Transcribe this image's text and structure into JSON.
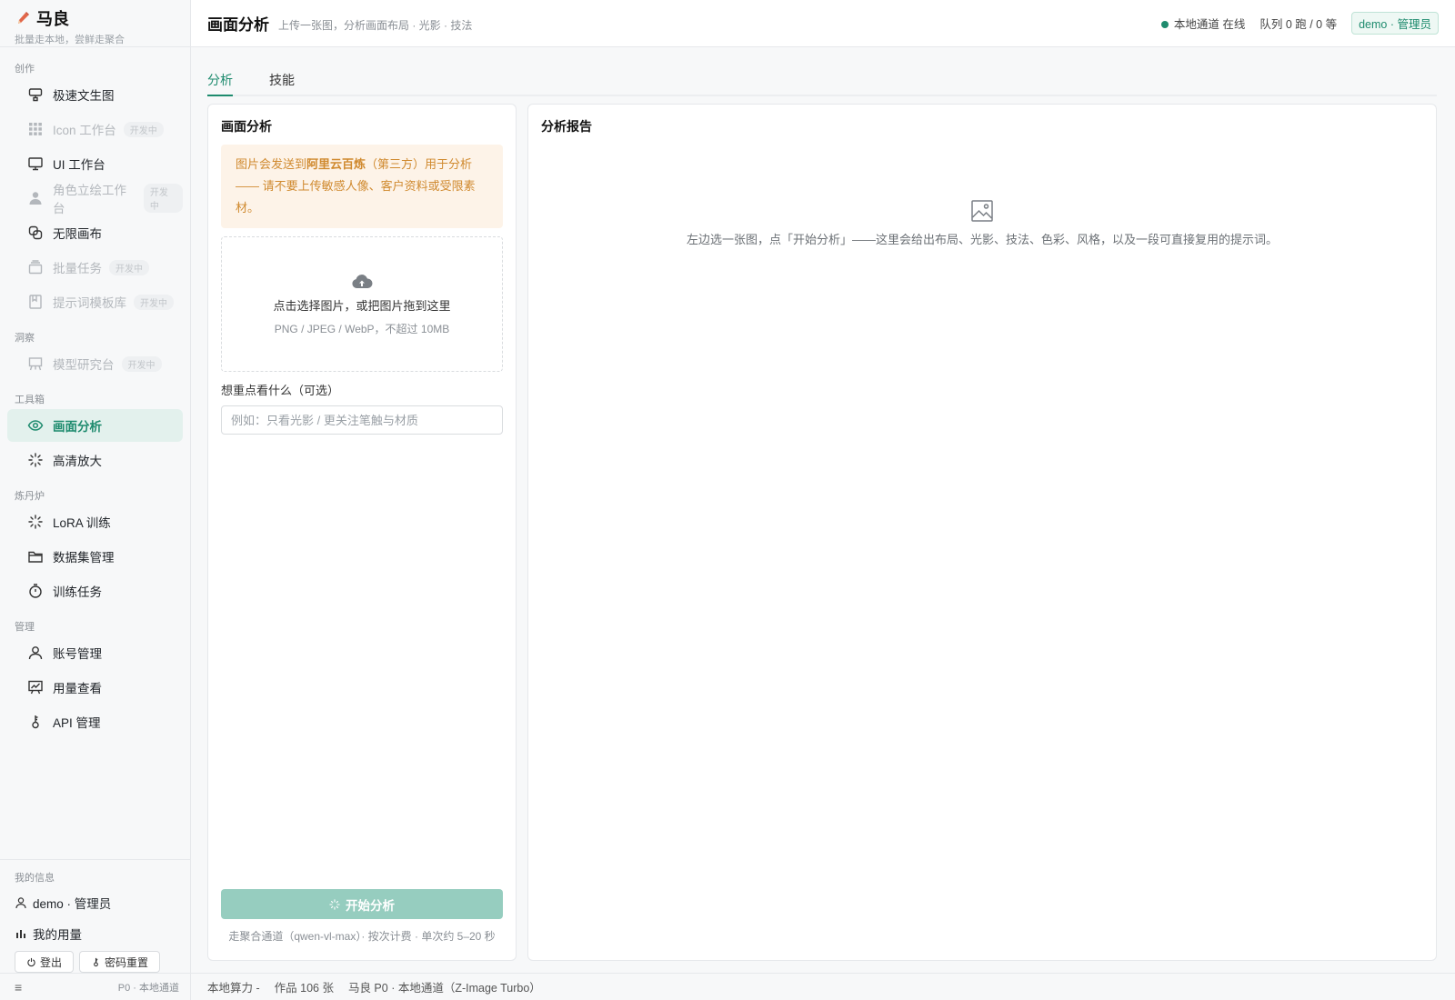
{
  "brand": {
    "title": "马良",
    "subtitle": "批量走本地，尝鲜走聚合"
  },
  "sidebar": {
    "sections": [
      {
        "label": "创作"
      },
      {
        "label": "洞察"
      },
      {
        "label": "工具箱"
      },
      {
        "label": "炼丹炉"
      },
      {
        "label": "管理"
      }
    ],
    "items": [
      {
        "label": "极速文生图",
        "icon": "palette-icon"
      },
      {
        "label": "Icon 工作台",
        "tag": "开发中",
        "icon": "grid-icon"
      },
      {
        "label": "UI 工作台",
        "icon": "monitor-icon"
      },
      {
        "label": "角色立绘工作台",
        "tag": "开发中",
        "icon": "person-icon"
      },
      {
        "label": "无限画布",
        "icon": "layers-icon"
      },
      {
        "label": "批量任务",
        "tag": "开发中",
        "icon": "stack-icon"
      },
      {
        "label": "提示词模板库",
        "tag": "开发中",
        "icon": "bookmark-icon"
      },
      {
        "label": "模型研究台",
        "tag": "开发中",
        "icon": "easel-icon"
      },
      {
        "label": "画面分析",
        "icon": "eye-icon",
        "active": true
      },
      {
        "label": "高清放大",
        "icon": "sparkle-icon"
      },
      {
        "label": "LoRA 训练",
        "icon": "sparkle-icon"
      },
      {
        "label": "数据集管理",
        "icon": "folder-icon"
      },
      {
        "label": "训练任务",
        "icon": "timer-icon"
      },
      {
        "label": "账号管理",
        "icon": "user-icon"
      },
      {
        "label": "用量查看",
        "icon": "chart-board-icon"
      },
      {
        "label": "API 管理",
        "icon": "key-icon"
      }
    ],
    "me": {
      "section": "我的信息",
      "user": "demo · 管理员",
      "usage": "我的用量",
      "logout": "登出",
      "reset": "密码重置"
    },
    "footer": {
      "menu_icon": "≡",
      "channel": "P0 · 本地通道"
    }
  },
  "header": {
    "title": "画面分析",
    "subtitle": "上传一张图，分析画面布局 · 光影 · 技法",
    "status": "本地通道 在线",
    "queue": "队列 0 跑 / 0 等",
    "role": "demo · 管理员"
  },
  "tabs": [
    {
      "label": "分析",
      "active": true
    },
    {
      "label": "技能"
    }
  ],
  "left_panel": {
    "title": "画面分析",
    "warning": {
      "part1": "图片会发送到",
      "bold": "阿里云百炼",
      "part2": "（第三方）用于分析 —— 请不要上传敏感人像、客户资料或受限素材。"
    },
    "dropzone": {
      "main": "点击选择图片，或把图片拖到这里",
      "hint": "PNG / JPEG / WebP，不超过 10MB"
    },
    "focus_label": "想重点看什么（可选）",
    "focus_placeholder": "例如：只看光影 / 更关注笔触与材质",
    "start_button": "开始分析",
    "start_note": "走聚合通道（qwen-vl-max）· 按次计费 · 单次约 5–20 秒"
  },
  "right_panel": {
    "title": "分析报告",
    "empty_text": "左边选一张图，点「开始分析」——这里会给出布局、光影、技法、色彩、风格，以及一段可直接复用的提示词。"
  },
  "statusbar": {
    "compute": "本地算力 -",
    "works": "作品 106 张",
    "model": "马良 P0 · 本地通道（Z-Image Turbo）"
  },
  "colors": {
    "accent": "#1e8b6e",
    "warning_bg": "#fdf3e8",
    "warning_text": "#d08a2f"
  }
}
